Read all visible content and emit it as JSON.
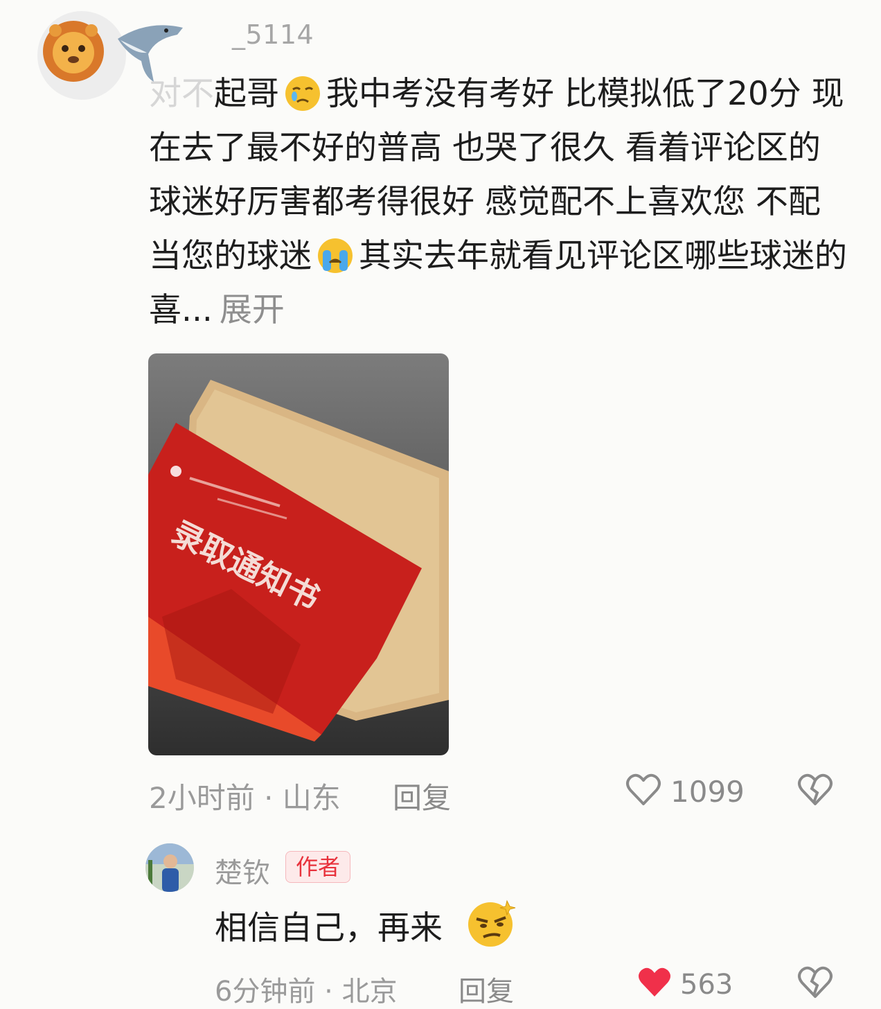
{
  "comment": {
    "username": "_5114",
    "text_faded": "对不",
    "text_part1": "起哥",
    "text_part2": "我中考没有考好 比模拟低了20分 现在去了最不好的普高 也哭了很久 看着评论区的球迷好厉害都考得很好 感觉配不上喜欢您 不配当您的球迷",
    "text_part3": "其实去年就看见评论区哪些球迷的喜...",
    "expand_label": "展开",
    "photo_label": "录取通知书",
    "time_location": "2小时前 · 山东",
    "reply_label": "回复",
    "like_count": "1099"
  },
  "reply": {
    "username": "楚钦",
    "badge": "作者",
    "text": "相信自己，再来",
    "time_location": "6分钟前 · 北京",
    "reply_label": "回复",
    "like_count": "563"
  },
  "colors": {
    "accent_red": "#e8323c",
    "muted_text": "#9a9a9a"
  },
  "icons": [
    "lion-avatar-icon",
    "shark-icon",
    "crying-face-icon",
    "sobbing-face-icon",
    "heart-outline-icon",
    "broken-heart-icon",
    "heart-filled-icon",
    "smirk-face-icon"
  ]
}
